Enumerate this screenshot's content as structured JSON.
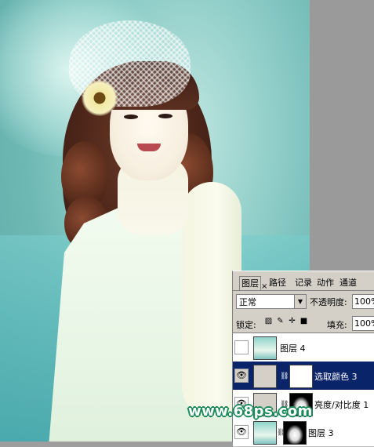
{
  "panel": {
    "tabs": [
      "图层",
      "路径",
      "记录",
      "动作",
      "通道"
    ],
    "tab_close": "×",
    "blend_mode": "正常",
    "opacity_label": "不透明度:",
    "opacity_value": "100%",
    "lock_label": "锁定:",
    "fill_label": "填充:",
    "fill_value": "100%",
    "layers": [
      {
        "name": "图层 4",
        "visible": false,
        "selected": false
      },
      {
        "name": "选取颜色 3",
        "visible": true,
        "selected": true
      },
      {
        "name": "亮度/对比度 1",
        "visible": true,
        "selected": false
      },
      {
        "name": "图层 3",
        "visible": true,
        "selected": false
      }
    ]
  },
  "icons": {
    "eye": "eye-icon",
    "chain": "link-icon",
    "dropdown": "chevron-down-icon",
    "lock_transparent": "lock-transparency-icon",
    "lock_paint": "lock-paint-icon",
    "lock_move": "lock-position-icon",
    "lock_all": "lock-all-icon"
  },
  "watermark": "www.68ps.com",
  "colors": {
    "selected_row": "#0a246a",
    "panel_bg": "#d4d0c8",
    "watermark_outline": "#1a8a5a"
  }
}
